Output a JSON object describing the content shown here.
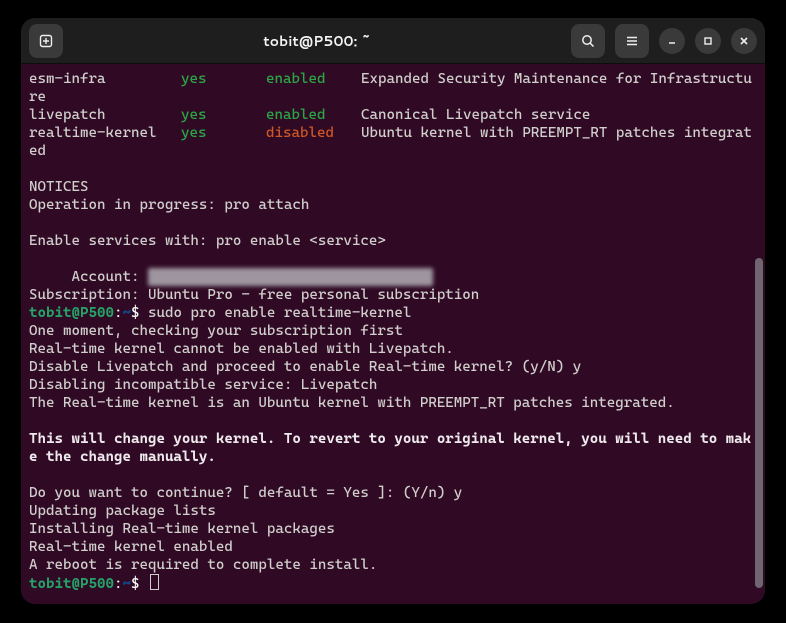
{
  "window": {
    "title": "tobit@P500: ~"
  },
  "prompt": {
    "user_host": "tobit@P500",
    "colon": ":",
    "path": "~",
    "dollar": "$"
  },
  "table": {
    "rows": [
      {
        "name": "esm-infra",
        "entitled": "yes",
        "status": "enabled",
        "status_class": "green",
        "desc": "Expanded Security Maintenance for Infrastructure"
      },
      {
        "name": "livepatch",
        "entitled": "yes",
        "status": "enabled",
        "status_class": "green",
        "desc": "Canonical Livepatch service"
      },
      {
        "name": "realtime-kernel",
        "entitled": "yes",
        "status": "disabled",
        "status_class": "orange",
        "desc": "Ubuntu kernel with PREEMPT_RT patches integrated"
      }
    ]
  },
  "body": {
    "notices_header": "NOTICES",
    "notices_line": "Operation in progress: pro attach",
    "enable_hint": "Enable services with: pro enable <service>",
    "account_label": "     Account: ",
    "account_blur": "xxxxxxxxxxxxxxxxxxxxxxxxxxxxxx",
    "subscription": "Subscription: Ubuntu Pro - free personal subscription",
    "cmd1": " sudo pro enable realtime-kernel",
    "out": [
      "One moment, checking your subscription first",
      "Real-time kernel cannot be enabled with Livepatch.",
      "Disable Livepatch and proceed to enable Real-time kernel? (y/N) y",
      "Disabling incompatible service: Livepatch",
      "The Real-time kernel is an Ubuntu kernel with PREEMPT_RT patches integrated."
    ],
    "bold_warning": "This will change your kernel. To revert to your original kernel, you will need to make the change manually.",
    "out2": [
      "Do you want to continue? [ default = Yes ]: (Y/n) y",
      "Updating package lists",
      "Installing Real-time kernel packages",
      "Real-time kernel enabled",
      "A reboot is required to complete install."
    ]
  }
}
